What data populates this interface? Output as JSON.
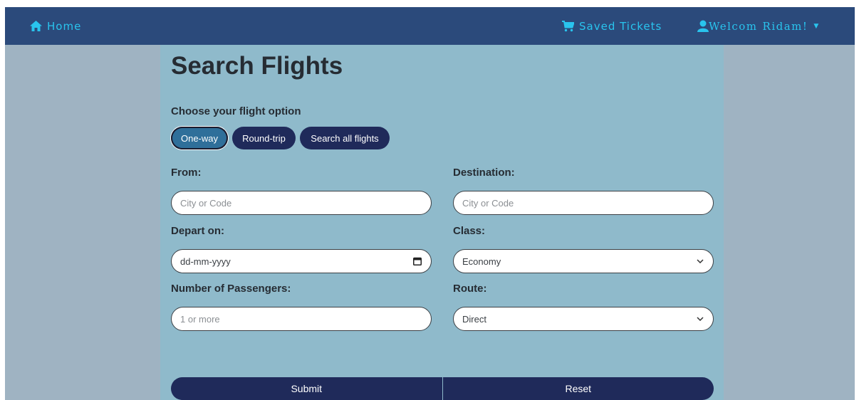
{
  "navbar": {
    "home_label": "Home",
    "saved_label": "Saved Tickets",
    "user_label": "Welcom",
    "user_name": "Ridam!",
    "icon_color": "#29c4ee",
    "background": "#2b4a7b"
  },
  "page": {
    "title": "Search Flights",
    "option_label": "Choose your flight option"
  },
  "flight_options": {
    "one_way": "One-way",
    "round_trip": "Round-trip",
    "all_flights": "Search all flights",
    "selected": "One-way"
  },
  "form": {
    "from_label": "From:",
    "from_placeholder": "City or Code",
    "destination_label": "Destination:",
    "destination_placeholder": "City or Code",
    "depart_label": "Depart on:",
    "depart_placeholder": "dd-mm-yyyy",
    "class_label": "Class:",
    "class_value": "Economy",
    "passengers_label": "Number of Passengers:",
    "passengers_placeholder": "1 or more",
    "route_label": "Route:",
    "route_value": "Direct"
  },
  "actions": {
    "submit": "Submit",
    "reset": "Reset"
  },
  "icons": {
    "home": "home-icon",
    "cart": "cart-icon",
    "user": "user-icon",
    "calendar": "calendar-icon",
    "dropdown": "chevron-down-icon"
  }
}
